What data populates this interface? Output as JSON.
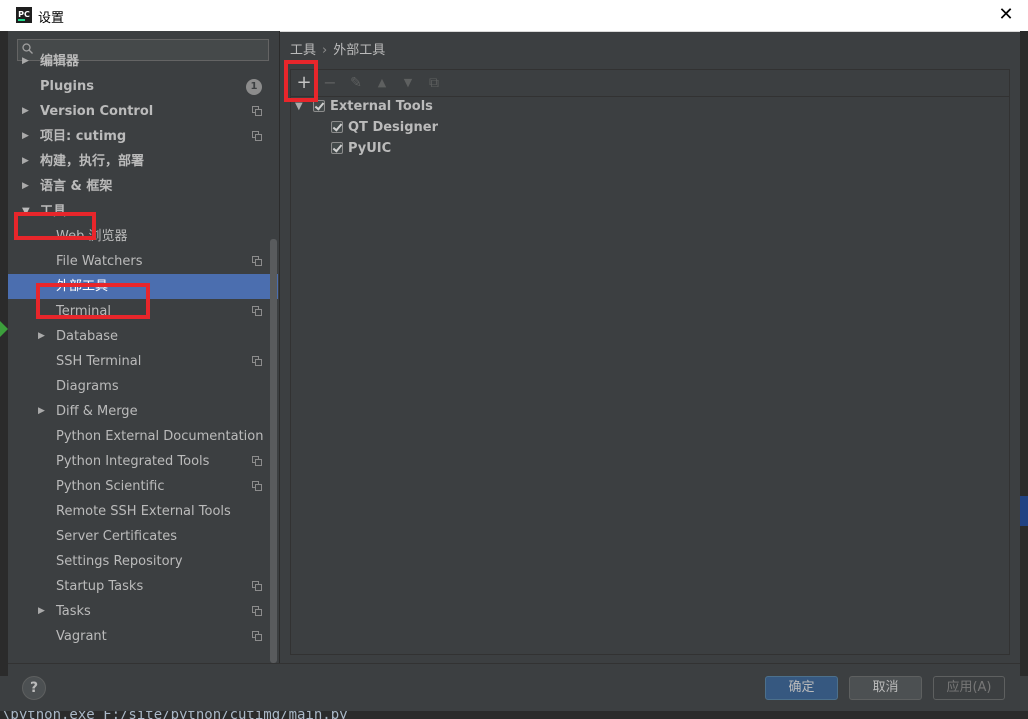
{
  "window": {
    "title": "设置",
    "app_icon_text": "PC",
    "close_glyph": "✕"
  },
  "sidebar": {
    "search_placeholder": "",
    "items": [
      {
        "label": "编辑器",
        "bold": true,
        "level": 0,
        "arrow": "▶",
        "copy": false
      },
      {
        "label": "Plugins",
        "bold": true,
        "level": 0,
        "arrow": "",
        "badge": "1"
      },
      {
        "label": "Version Control",
        "bold": true,
        "level": 0,
        "arrow": "▶",
        "copy": true
      },
      {
        "label": "项目: cutimg",
        "bold": true,
        "level": 0,
        "arrow": "▶",
        "copy": true
      },
      {
        "label": "构建，执行，部署",
        "bold": true,
        "level": 0,
        "arrow": "▶",
        "copy": false
      },
      {
        "label": "语言 & 框架",
        "bold": true,
        "level": 0,
        "arrow": "▶",
        "copy": false
      },
      {
        "label": "工具",
        "bold": true,
        "level": 0,
        "arrow": "▼",
        "copy": false
      },
      {
        "label": "Web 浏览器",
        "level": 1,
        "arrow": "",
        "copy": false
      },
      {
        "label": "File Watchers",
        "level": 1,
        "arrow": "",
        "copy": true
      },
      {
        "label": "外部工具",
        "level": 1,
        "arrow": "",
        "copy": false,
        "selected": true
      },
      {
        "label": "Terminal",
        "level": 1,
        "arrow": "",
        "copy": true
      },
      {
        "label": "Database",
        "level": 1,
        "arrow": "▶",
        "copy": false
      },
      {
        "label": "SSH Terminal",
        "level": 1,
        "arrow": "",
        "copy": true
      },
      {
        "label": "Diagrams",
        "level": 1,
        "arrow": "",
        "copy": false
      },
      {
        "label": "Diff & Merge",
        "level": 1,
        "arrow": "▶",
        "copy": false
      },
      {
        "label": "Python External Documentation",
        "level": 1,
        "arrow": "",
        "copy": false
      },
      {
        "label": "Python Integrated Tools",
        "level": 1,
        "arrow": "",
        "copy": true
      },
      {
        "label": "Python Scientific",
        "level": 1,
        "arrow": "",
        "copy": true
      },
      {
        "label": "Remote SSH External Tools",
        "level": 1,
        "arrow": "",
        "copy": false
      },
      {
        "label": "Server Certificates",
        "level": 1,
        "arrow": "",
        "copy": false
      },
      {
        "label": "Settings Repository",
        "level": 1,
        "arrow": "",
        "copy": false
      },
      {
        "label": "Startup Tasks",
        "level": 1,
        "arrow": "",
        "copy": true
      },
      {
        "label": "Tasks",
        "level": 1,
        "arrow": "▶",
        "copy": true
      },
      {
        "label": "Vagrant",
        "level": 1,
        "arrow": "",
        "copy": true
      }
    ]
  },
  "content": {
    "breadcrumb": {
      "parent": "工具",
      "separator": "›",
      "current": "外部工具"
    },
    "toolbar": {
      "add": "+",
      "remove": "−",
      "edit": "✎",
      "up": "▲",
      "down": "▼",
      "copy": "⧉"
    },
    "tools": {
      "group": {
        "label": "External Tools",
        "checked": true,
        "arrow": "▼"
      },
      "children": [
        {
          "label": "QT Designer",
          "checked": true
        },
        {
          "label": "PyUIC",
          "checked": true
        }
      ]
    }
  },
  "footer": {
    "help": "?",
    "ok": "确定",
    "cancel": "取消",
    "apply": "应用(A)"
  },
  "background_text": "\\python.exe F:/site/python/cutimg/main.py",
  "colors": {
    "highlight": "#e8262b",
    "selection": "#4b6eaf",
    "ok_button": "#365880"
  }
}
